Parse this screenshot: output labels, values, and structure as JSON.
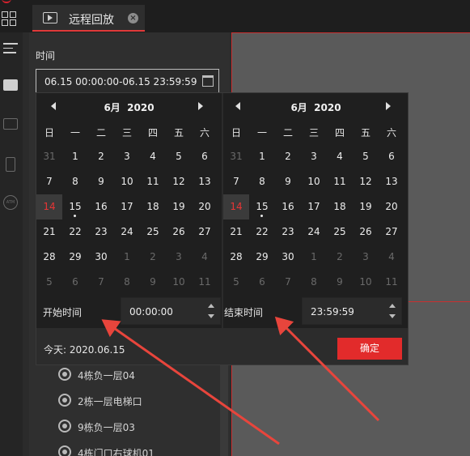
{
  "tab": {
    "title": "远程回放",
    "close_glyph": "×"
  },
  "sidebar_nav": {
    "atm_label": "ATM"
  },
  "panel": {
    "time_label": "时间",
    "time_range": "06.15 00:00:00-06.15 23:59:59",
    "tree_items": [
      "4栋负一层04",
      "2栋一层电梯口",
      "9栋负一层03",
      "4栋门口右球机01"
    ]
  },
  "calendar": {
    "left": {
      "month_label": "6月",
      "year_label": "2020",
      "weekdays": [
        "日",
        "一",
        "二",
        "三",
        "四",
        "五",
        "六"
      ],
      "days": [
        "31",
        "1",
        "2",
        "3",
        "4",
        "5",
        "6",
        "7",
        "8",
        "9",
        "10",
        "11",
        "12",
        "13",
        "14",
        "15",
        "16",
        "17",
        "18",
        "19",
        "20",
        "21",
        "22",
        "23",
        "24",
        "25",
        "26",
        "27",
        "28",
        "29",
        "30",
        "1",
        "2",
        "3",
        "4",
        "5",
        "6",
        "7",
        "8",
        "9",
        "10",
        "11"
      ]
    },
    "right": {
      "month_label": "6月",
      "year_label": "2020",
      "weekdays": [
        "日",
        "一",
        "二",
        "三",
        "四",
        "五",
        "六"
      ],
      "days": [
        "31",
        "1",
        "2",
        "3",
        "4",
        "5",
        "6",
        "7",
        "8",
        "9",
        "10",
        "11",
        "12",
        "13",
        "14",
        "15",
        "16",
        "17",
        "18",
        "19",
        "20",
        "21",
        "22",
        "23",
        "24",
        "25",
        "26",
        "27",
        "28",
        "29",
        "30",
        "1",
        "2",
        "3",
        "4",
        "5",
        "6",
        "7",
        "8",
        "9",
        "10",
        "11"
      ]
    },
    "start_time_label": "开始时间",
    "start_time_value": "00:00:00",
    "end_time_label": "结束时间",
    "end_time_value": "23:59:59",
    "today_text": "今天: 2020.06.15",
    "confirm_label": "确定"
  },
  "colors": {
    "accent": "#e22b2b",
    "today_text": "#e63535",
    "annotation_arrow": "#e8453c"
  }
}
